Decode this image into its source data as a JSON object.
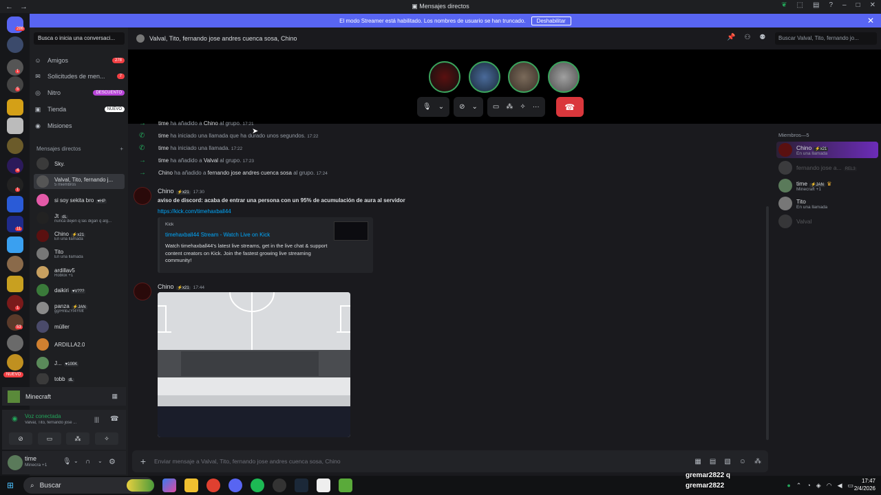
{
  "window": {
    "title": "Mensajes directos",
    "nav_back": "←",
    "nav_forward": "→"
  },
  "banner": {
    "text": "El modo Streamer está habilitado. Los nombres de usuario se han truncado.",
    "button": "Deshabilitar",
    "close": "✕"
  },
  "rail": {
    "badges": [
      "286",
      "1",
      "5",
      "4",
      "1",
      "11",
      "1",
      "53"
    ],
    "new_label": "NUEVO"
  },
  "sidebar": {
    "search_placeholder": "Busca o inicia una conversaci...",
    "nav": [
      {
        "label": "Amigos",
        "count": "278",
        "icon": "friends-icon"
      },
      {
        "label": "Solicitudes de men...",
        "count": "7",
        "icon": "envelope-icon"
      },
      {
        "label": "Nitro",
        "pill": "DESCUENTO",
        "icon": "nitro-icon"
      },
      {
        "label": "Tienda",
        "pill": "NUEVO",
        "icon": "shop-icon"
      },
      {
        "label": "Misiones",
        "icon": "quest-icon"
      }
    ],
    "dm_header": "Mensajes directos",
    "dm_add": "+",
    "dms": [
      {
        "name": "Sky.",
        "sub": ""
      },
      {
        "name": "Valval, Tito, fernando j...",
        "sub": "5 miembros"
      },
      {
        "name": "si soy sekita bro",
        "tag": "♥HP",
        "sub": ""
      },
      {
        "name": "Jt",
        "tag": "dL",
        "sub": "nunca dejen q las digan q alg..."
      },
      {
        "name": "Chino",
        "tag": "⚡x21",
        "sub": "En una llamada"
      },
      {
        "name": "Tito",
        "sub": "En una llamada"
      },
      {
        "name": "ardillav5",
        "sub": "Roblox +1"
      },
      {
        "name": "daikiri",
        "tag": "♥V???",
        "sub": ""
      },
      {
        "name": "panza",
        "tag": "⚡JAN",
        "sub": "gg/HnbZYt4YMt"
      },
      {
        "name": "müller",
        "sub": ""
      },
      {
        "name": "ARDILLA2.0",
        "sub": ""
      },
      {
        "name": "J...",
        "tag": "♥100K",
        "sub": ""
      },
      {
        "name": "tobb",
        "tag": "dL",
        "sub": ""
      }
    ]
  },
  "game_panel": {
    "name": "Minecraft"
  },
  "voice_panel": {
    "status": "Voz conectada",
    "channel": "Valval, Tito, fernando jose ..."
  },
  "user_panel": {
    "name": "time",
    "status": "Minecra +1"
  },
  "chat": {
    "header": "Valval, Tito, fernando jose andres cuenca sosa, Chino",
    "search_placeholder": "Buscar Valval, Tito, fernando jo...",
    "system": [
      {
        "actor": "time",
        "text": "ha añadido a",
        "target": "Chino",
        "suffix": "al grupo.",
        "time": "17:21"
      },
      {
        "actor": "time",
        "text": "ha iniciado una llamada que ha durado unos segundos.",
        "target": "",
        "suffix": "",
        "time": "17:22"
      },
      {
        "actor": "time",
        "text": "ha iniciado una llamada.",
        "target": "",
        "suffix": "",
        "time": "17:22"
      },
      {
        "actor": "time",
        "text": "ha añadido a",
        "target": "Valval",
        "suffix": "al grupo.",
        "time": "17:23"
      },
      {
        "actor": "Chino",
        "text": "ha añadido a",
        "target": "fernando jose andres cuenca sosa",
        "suffix": "al grupo.",
        "time": "17:24"
      }
    ],
    "messages": [
      {
        "author": "Chino",
        "tag": "⚡x21",
        "time": "17:30",
        "text": "aviso de discord: acaba de entrar una persona con un 95% de acumulación de aura al servidor",
        "link": "https://kick.com/timehaxball44",
        "embed": {
          "provider": "Kick",
          "title": "timehaxball44 Stream - Watch Live on Kick",
          "description": "Watch timehaxball44's latest live streams, get in the live chat & support content creators on Kick. Join the fastest growing live streaming community!"
        }
      },
      {
        "author": "Chino",
        "tag": "⚡x21",
        "time": "17:44"
      }
    ],
    "composer_placeholder": "Enviar mensaje a Valval, Tito, fernando jose andres cuenca sosa, Chino"
  },
  "members": {
    "header": "Miembros—5",
    "list": [
      {
        "name": "Chino",
        "tag": "⚡x21",
        "sub": "En una llamada"
      },
      {
        "name": "fernando jose a...",
        "tag": "REL3",
        "sub": ""
      },
      {
        "name": "time",
        "tag": "⚡JAN",
        "sub": "Minecraft +1"
      },
      {
        "name": "Tito",
        "sub": "En una llamada"
      },
      {
        "name": "Valval",
        "sub": ""
      }
    ]
  },
  "taskbar": {
    "search": "Buscar",
    "overlay_lines": [
      "gremar2822  q",
      "gremar2822"
    ],
    "time": "17:47",
    "date": "2/4/2026"
  }
}
